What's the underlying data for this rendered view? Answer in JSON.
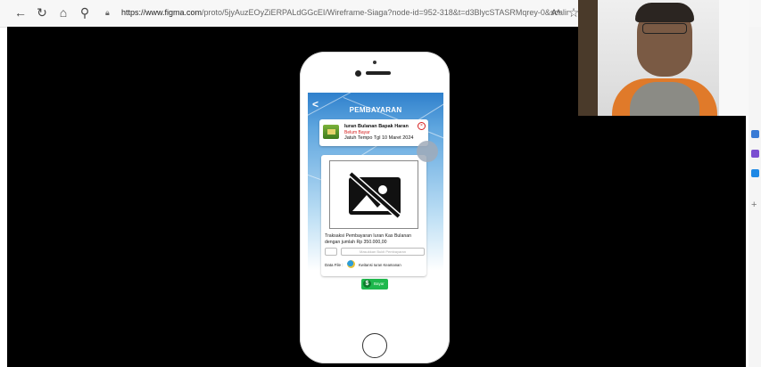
{
  "browser": {
    "url_host": "https://www.figma.com",
    "url_path": "/proto/5jyAuzEOyZiERPALdGGcEI/Wireframe-Siaga?node-id=952-318&t=d3BlycSTASRMqrey-0&scaling=scale-d...",
    "reader_label": "Aᴬ",
    "icons": [
      "back-icon",
      "refresh-icon",
      "home-icon",
      "search-icon",
      "lock-icon",
      "reader-icon",
      "favorite-icon"
    ]
  },
  "app": {
    "screen_title": "PEMBAYARAN",
    "back_glyph": "<",
    "bill": {
      "title": "Iuran Bulanan Bapak Haran",
      "status": "Belum Bayar",
      "due": "Jatuh Tempo Tgl 10 Maret 2024",
      "close_glyph": "×"
    },
    "detail": {
      "description": "Traksaksi Pembayaran Iuran Kas Bulanan dengan jumlah Rp 350.000,00",
      "upload_button": "Masukkan Bukti Pembayaran",
      "file_label": "Data File :",
      "file_name": "Kwitansi Iuran Keamanan"
    },
    "pay_button": {
      "icon_glyph": "$",
      "label": "Bayar"
    }
  },
  "colors": {
    "header_blue": "#2f80cc",
    "status_red": "#d62020",
    "pay_green": "#1fb84d"
  }
}
